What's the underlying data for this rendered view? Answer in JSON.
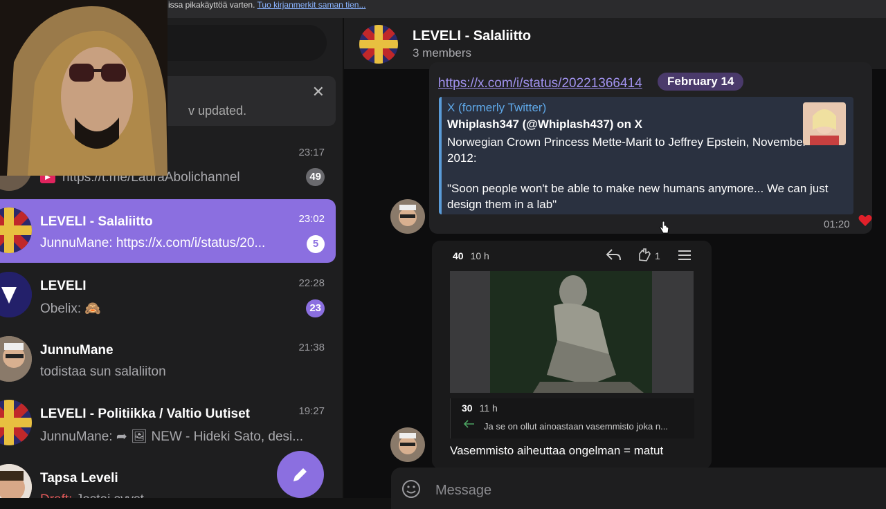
{
  "browser_bar": {
    "message": "issa pikakäyttöä varten.",
    "link": "Tuo kirjanmerkit saman tien..."
  },
  "banner": {
    "text": "v  updated."
  },
  "chats": [
    {
      "name": "",
      "preview": "https://t.me/LauraAbolichannel",
      "time": "23:17",
      "badge": "49"
    },
    {
      "name": "LEVELI - Salaliitto",
      "preview": "JunnuMane: https://x.com/i/status/20...",
      "time": "23:02",
      "badge": "5"
    },
    {
      "name": "LEVELI",
      "preview": "Obelix: 🙈",
      "time": "22:28",
      "badge": "23"
    },
    {
      "name": "JunnuMane",
      "preview": "todistaa sun salaliiton",
      "time": "21:38",
      "badge": ""
    },
    {
      "name": "LEVELI - Politiikka / Valtio Uutiset",
      "preview": "JunnuMane: ➦ 🖼 NEW - Hideki Sato, desi...",
      "time": "19:27",
      "badge": ""
    },
    {
      "name": "Tapsa Leveli",
      "draft_label": "Draft:",
      "preview": " Jostai syyst",
      "time": "",
      "badge": ""
    }
  ],
  "header": {
    "title": "LEVELI - Salaliitto",
    "subtitle": "3 members"
  },
  "message1": {
    "link": "https://x.com/i/status/20221366414",
    "date_pill": "February 14",
    "preview_site": "X (formerly Twitter)",
    "preview_title": "Whiplash347 (@Whiplash437) on X",
    "preview_text": "Norwegian Crown Princess Mette-Marit to Jeffrey Epstein, November 2012:",
    "preview_quote": "\"Soon people won't be able to make new humans anymore... We can just design them in a lab\"",
    "time": "01:20"
  },
  "message2": {
    "score": "40",
    "age": "10 h",
    "clap_count": "1",
    "sub_score": "30",
    "sub_age": "11 h",
    "sub_text": "Ja se on ollut ainoastaan vasemmisto joka n...",
    "text": "Vasemmisto aiheuttaa ongelman =  matut"
  },
  "composer": {
    "placeholder": "Message"
  },
  "colors": {
    "accent": "#8b6fe0",
    "link": "#a293f0",
    "preview_border": "#5a9bd8",
    "heart": "#e0202a"
  }
}
